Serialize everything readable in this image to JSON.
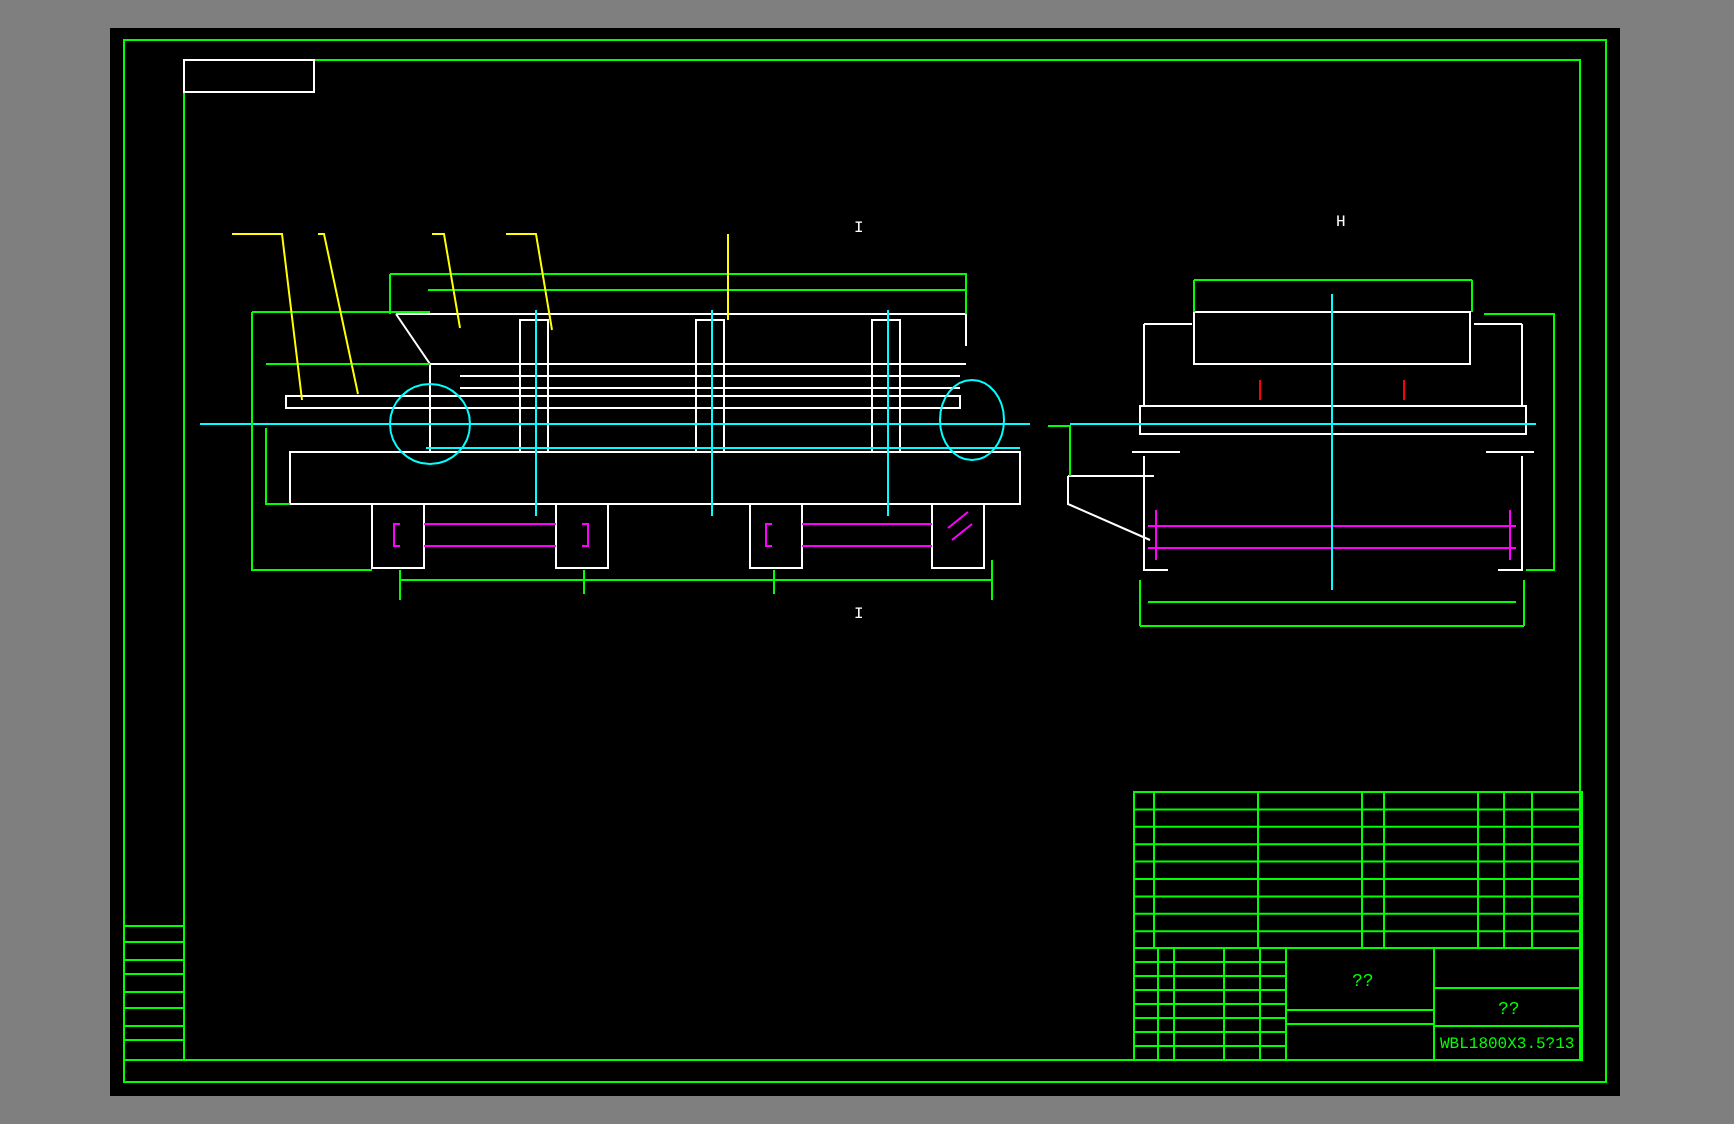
{
  "drawing": {
    "section_marks": [
      {
        "label": "I",
        "kind": "top"
      },
      {
        "label": "I",
        "kind": "bottom"
      },
      {
        "label": "H",
        "kind": "side"
      }
    ],
    "title_block": {
      "title": "??",
      "name": "??",
      "drawing_number": "WBL1800X3.5?13"
    }
  }
}
